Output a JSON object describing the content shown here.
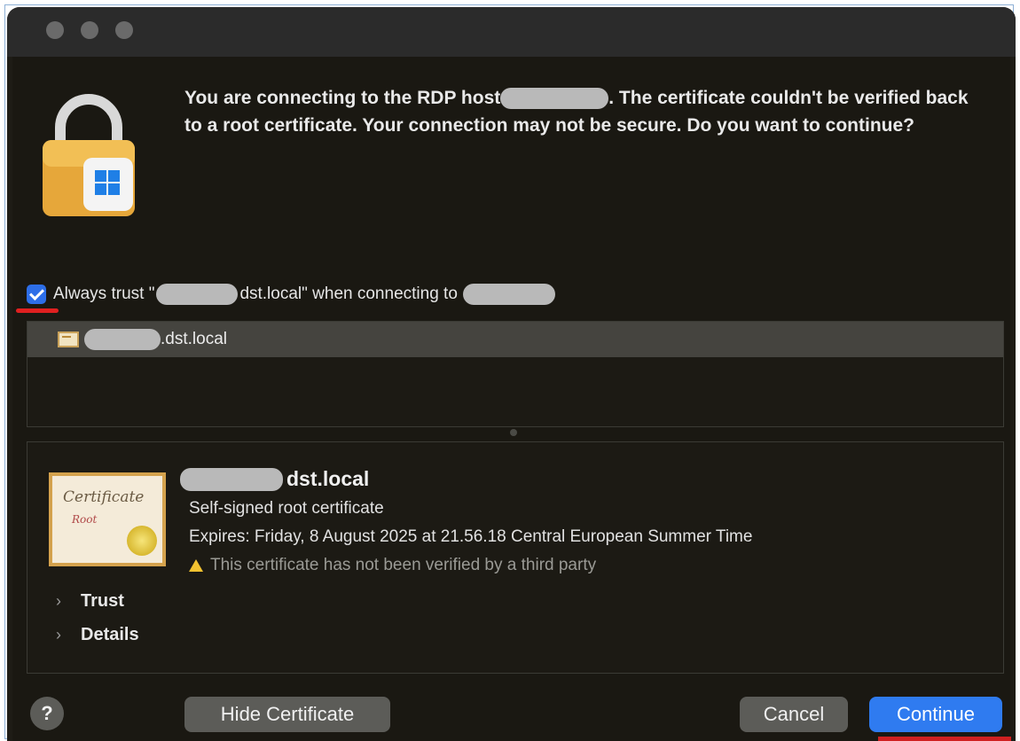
{
  "dialog": {
    "message_part1": "You are connecting to the RDP host",
    "message_part2": ". The certificate couldn't be verified back to a root certificate. Your connection may not be secure. Do you want to continue?"
  },
  "trust": {
    "checked": true,
    "label_prefix": "Always trust \"",
    "label_middle": "dst.local\" when connecting to"
  },
  "cert_list": {
    "items": [
      {
        "name_suffix": ".dst.local",
        "icon": "certificate-icon"
      }
    ]
  },
  "certificate": {
    "icon_title": "Certificate",
    "icon_subtitle": "Root",
    "name_suffix": "dst.local",
    "type": "Self-signed root certificate",
    "expires": "Expires: Friday, 8 August 2025 at 21.56.18 Central European Summer Time",
    "warning": "This certificate has not been verified by a third party"
  },
  "disclosures": {
    "trust": "Trust",
    "details": "Details"
  },
  "buttons": {
    "help": "?",
    "hide_certificate": "Hide Certificate",
    "cancel": "Cancel",
    "continue": "Continue"
  },
  "colors": {
    "accent": "#2f7bf0",
    "window_bg": "#1a1812",
    "highlight_red": "#e02020"
  }
}
